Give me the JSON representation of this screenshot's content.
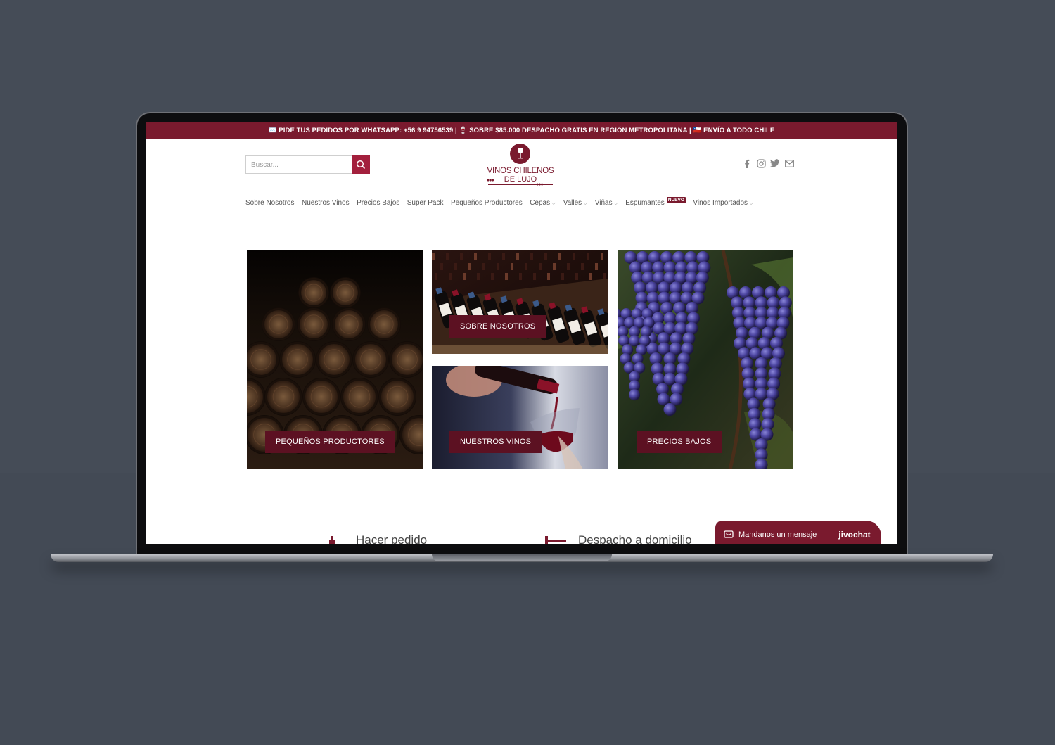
{
  "topbar": {
    "text": "✉️ PIDE TUS PEDIDOS POR WHATSAPP: +56 9 94756539 | 🍷 SOBRE $85.000 DESPACHO GRATIS EN REGIÓN METROPOLITANA | 🇨🇱 ENVÍO A TODO CHILE"
  },
  "search": {
    "placeholder": "Buscar..."
  },
  "logo": {
    "line1": "VINOS CHILENOS",
    "line2": "DE LUJO"
  },
  "nav": {
    "items": [
      {
        "label": "Sobre Nosotros"
      },
      {
        "label": "Nuestros Vinos"
      },
      {
        "label": "Precios Bajos"
      },
      {
        "label": "Super Pack"
      },
      {
        "label": "Pequeños Productores"
      },
      {
        "label": "Cepas"
      },
      {
        "label": "Valles"
      },
      {
        "label": "Viñas"
      },
      {
        "label": "Espumantes"
      },
      {
        "label": "Vinos Importados"
      }
    ],
    "badge": "NUEVO"
  },
  "tiles": {
    "barrels": "PEQUEÑOS PRODUCTORES",
    "bottles": "SOBRE NOSOTROS",
    "pouring": "NUESTROS VINOS",
    "grapes": "PRECIOS BAJOS"
  },
  "features": {
    "order": "Hacer pedido",
    "delivery": "Despacho a domicilio"
  },
  "chat": {
    "message": "Mandanos un mensaje",
    "brand": "jivochat"
  },
  "colors": {
    "brand": "#7a1a2e",
    "accent": "#a3203d",
    "label_bg": "#5c1122"
  }
}
